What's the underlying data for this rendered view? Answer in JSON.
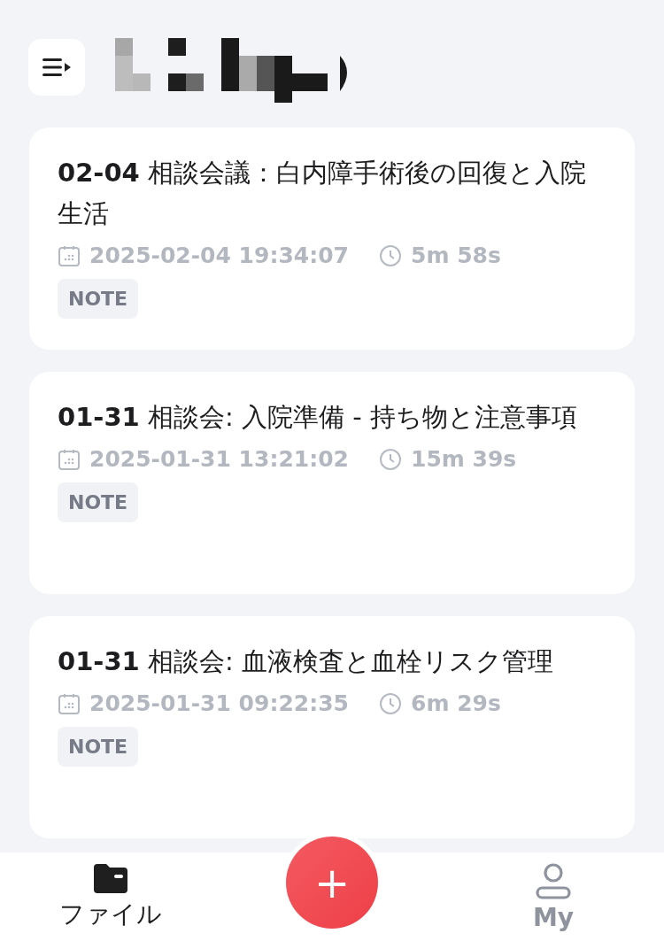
{
  "records": [
    {
      "title": "**02-04** 相談会議：白内障手術後の回復と入院生活",
      "datetime": "2025-02-04 19:34:07",
      "duration": "5m 58s",
      "tag": "NOTE"
    },
    {
      "title": "**01-31** 相談会: 入院準備 - 持ち物と注意事項",
      "datetime": "2025-01-31 13:21:02",
      "duration": "15m 39s",
      "tag": "NOTE"
    },
    {
      "title": "**01-31** 相談会: 血液検査と血栓リスク管理",
      "datetime": "2025-01-31 09:22:35",
      "duration": "6m 29s",
      "tag": "NOTE"
    }
  ],
  "bottom_nav": {
    "items": [
      {
        "label": "ファイル",
        "kind": "files",
        "selected": true
      },
      {
        "label": "My",
        "kind": "profile",
        "selected": false
      }
    ],
    "fab": "+"
  }
}
